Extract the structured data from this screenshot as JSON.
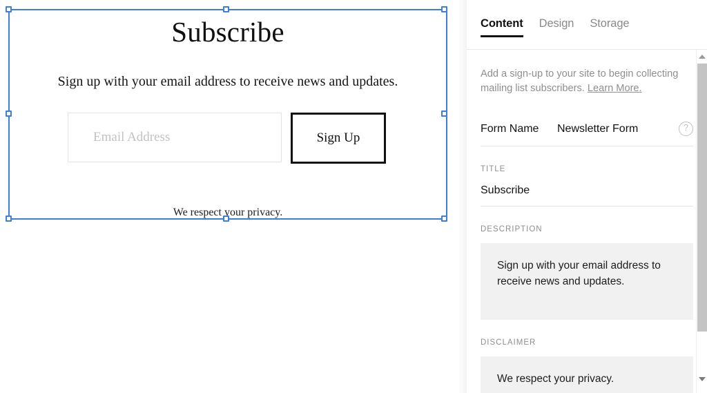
{
  "canvas": {
    "block": {
      "title": "Subscribe",
      "description": "Sign up with your email address to receive news and updates.",
      "email_placeholder": "Email Address",
      "email_value": "",
      "signup_label": "Sign Up",
      "disclaimer": "We respect your privacy."
    },
    "selection": {
      "accent_color": "#3d7ce0",
      "handle_fill": "#ffffff"
    }
  },
  "panel": {
    "tabs": [
      {
        "label": "Content",
        "active": true
      },
      {
        "label": "Design",
        "active": false
      },
      {
        "label": "Storage",
        "active": false
      }
    ],
    "intro": {
      "text": "Add a sign-up to your site to begin collecting mailing list subscribers.",
      "link_label": "Learn More."
    },
    "form_name": {
      "label": "Form Name",
      "value": "Newsletter Form",
      "help_glyph": "?"
    },
    "fields": [
      {
        "label": "TITLE",
        "value": "Subscribe"
      },
      {
        "label": "DESCRIPTION",
        "value": "Sign up with your email address to receive news and updates."
      },
      {
        "label": "DISCLAIMER",
        "value": "We respect your privacy."
      }
    ],
    "scrollbar": {
      "up_glyph": "▲",
      "down_glyph": "▼"
    }
  }
}
